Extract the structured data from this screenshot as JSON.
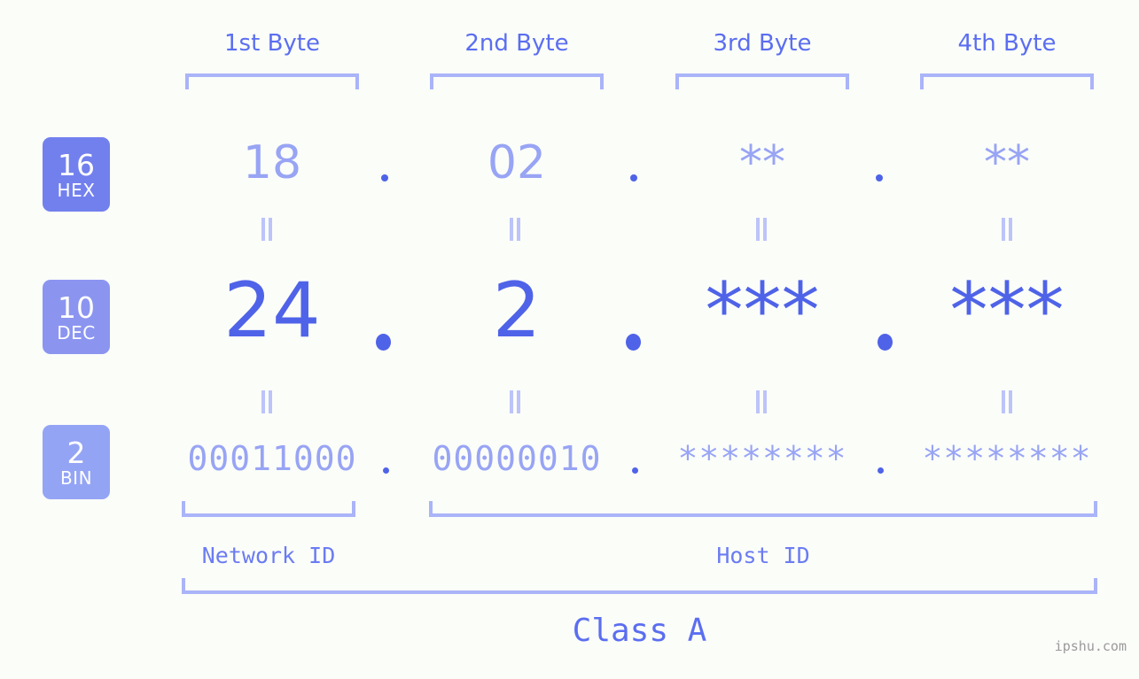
{
  "colors": {
    "background": "#fbfdf9",
    "accent_strong": "#4f63e8",
    "accent_light": "#98a4f4",
    "bracket": "#aab4f8",
    "badge_hex": "#7280ee",
    "badge_dec": "#8b95f0",
    "badge_bin": "#94a4f5",
    "watermark": "#9a9a9a"
  },
  "byte_headers": [
    {
      "label": "1st Byte"
    },
    {
      "label": "2nd Byte"
    },
    {
      "label": "3rd Byte"
    },
    {
      "label": "4th Byte"
    }
  ],
  "rows": {
    "hex": {
      "badge_base": "16",
      "badge_name": "HEX",
      "values": [
        "18",
        "02",
        "**",
        "**"
      ],
      "separator": "."
    },
    "dec": {
      "badge_base": "10",
      "badge_name": "DEC",
      "values": [
        "24",
        "2",
        "***",
        "***"
      ],
      "separator": "."
    },
    "bin": {
      "badge_base": "2",
      "badge_name": "BIN",
      "values": [
        "00011000",
        "00000010",
        "********",
        "********"
      ],
      "separator": "."
    }
  },
  "zones": [
    {
      "label": "Network ID"
    },
    {
      "label": "Host ID"
    }
  ],
  "class": {
    "label": "Class A"
  },
  "watermark": {
    "text": "ipshu.com"
  }
}
